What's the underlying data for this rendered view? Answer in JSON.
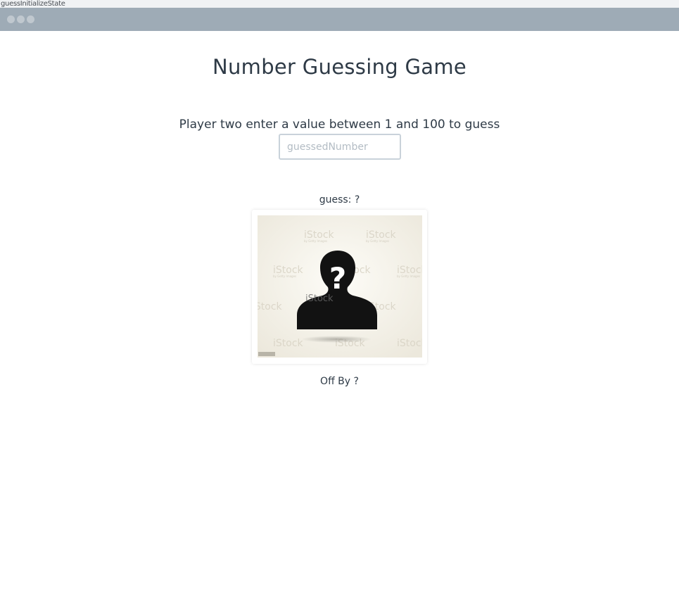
{
  "story": {
    "label": "guessInitializeState"
  },
  "header": {
    "title": "Number Guessing Game"
  },
  "form": {
    "prompt": "Player two enter a value between 1 and 100 to guess",
    "input_placeholder": "guessedNumber",
    "input_value": ""
  },
  "result": {
    "guess_text": "guess: ?",
    "image_icon": "mystery-person-icon",
    "image_mark": "?",
    "watermark": "iStock",
    "watermark_sub": "by Getty Images",
    "off_by_text": "Off By ?"
  },
  "colors": {
    "window_bar": "#9eabb6",
    "text": "#2e3a46",
    "input_border": "#c9d2da"
  }
}
